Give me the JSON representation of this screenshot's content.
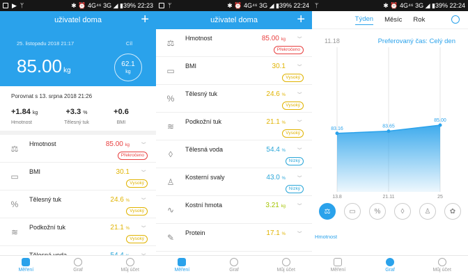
{
  "status": {
    "left_icons": [
      "image",
      "play",
      "usb"
    ],
    "right_p1": "✱ ⏰ 4G⁴⁶ 3G ◢ ▮39% 22:23",
    "right_p2": "✱ ⏰ 4G⁴⁶ 3G ◢ ▮39% 22:24",
    "right_p3": "✱ ⏰ 4G⁴⁶ 3G ◢ ▮39% 22:24"
  },
  "header": {
    "title": "uživatel doma",
    "plus": "+"
  },
  "hero": {
    "date": "25. listopadu 2018 21:17",
    "goal_label": "Cíl",
    "value": "85.00",
    "unit": "kg",
    "goal_value": "62.1",
    "goal_unit": "kg"
  },
  "compare": {
    "text": "Porovnat s 13. srpna 2018 21:26",
    "stats": [
      {
        "value": "+1.84",
        "unit": "kg",
        "label": "Hmotnost"
      },
      {
        "value": "+3.3",
        "unit": "%",
        "label": "Tělesný tuk"
      },
      {
        "value": "+0.6",
        "unit": "",
        "label": "BMI"
      }
    ]
  },
  "metrics": [
    {
      "name": "Hmotnost",
      "value": "85.00",
      "unit": "kg",
      "badge": "Překročeno",
      "color": "red",
      "icon": "scale-icon"
    },
    {
      "name": "BMI",
      "value": "30.1",
      "unit": "",
      "badge": "Vysoký",
      "color": "yel",
      "icon": "bmi-icon"
    },
    {
      "name": "Tělesný tuk",
      "value": "24.6",
      "unit": "%",
      "badge": "Vysoký",
      "color": "yel",
      "icon": "percent-icon"
    },
    {
      "name": "Podkožní tuk",
      "value": "21.1",
      "unit": "%",
      "badge": "Vysoký",
      "color": "yel",
      "icon": "subcutaneous-icon"
    },
    {
      "name": "Tělesná voda",
      "value": "54.4",
      "unit": "%",
      "badge": "Nízký",
      "color": "cy",
      "icon": "water-icon"
    },
    {
      "name": "Kosterní svaly",
      "value": "43.0",
      "unit": "%",
      "badge": "Nízký",
      "color": "cy",
      "icon": "muscle-icon"
    },
    {
      "name": "Kostní hmota",
      "value": "3.21",
      "unit": "kg",
      "badge": "",
      "color": "grn",
      "icon": "bone-icon"
    },
    {
      "name": "Protein",
      "value": "17.1",
      "unit": "%",
      "badge": "",
      "color": "yel",
      "icon": "protein-icon"
    }
  ],
  "nav": [
    {
      "label": "Měření"
    },
    {
      "label": "Graf"
    },
    {
      "label": "Můj účet"
    }
  ],
  "graph": {
    "tabs": [
      "Týden",
      "Měsíc",
      "Rok"
    ],
    "date": "11.18",
    "pref": "Preferovaný čas: Celý den",
    "metric_label": "Hmotnost"
  },
  "chart_data": {
    "type": "area",
    "x": [
      "13.8",
      "21.11",
      "25"
    ],
    "values": [
      83.16,
      83.65,
      85.0
    ],
    "labels": [
      "83.16",
      "83.65",
      "85.00"
    ],
    "color": "#2aa2eb"
  },
  "colors": {
    "accent": "#2aa2eb"
  }
}
